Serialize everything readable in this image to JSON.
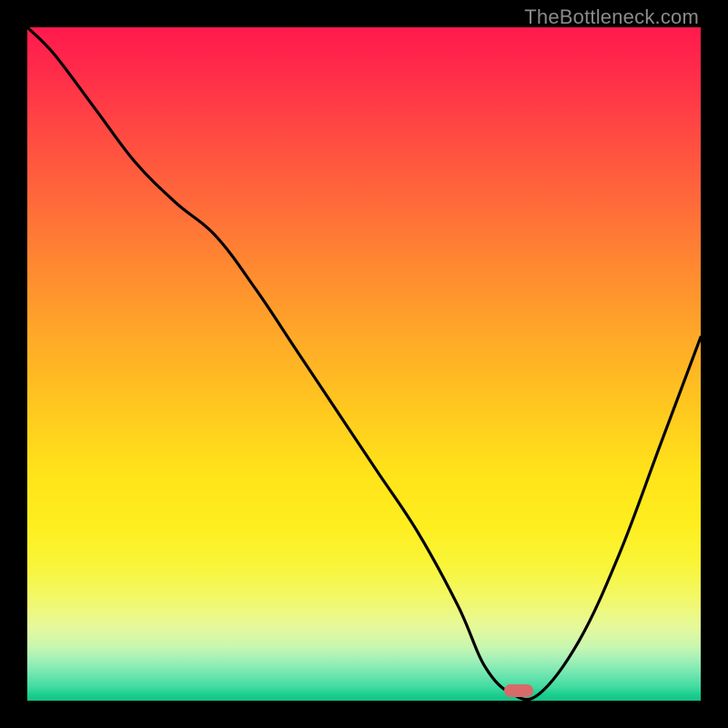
{
  "watermark": "TheBottleneck.com",
  "colors": {
    "frame": "#000000",
    "curve": "#000000",
    "marker": "#d96a6a"
  },
  "chart_data": {
    "type": "line",
    "title": "",
    "xlabel": "",
    "ylabel": "",
    "xlim": [
      0,
      100
    ],
    "ylim": [
      0,
      100
    ],
    "grid": false,
    "legend": false,
    "series": [
      {
        "name": "bottleneck-curve",
        "x": [
          0,
          4,
          10,
          16,
          22,
          28,
          34,
          40,
          46,
          52,
          58,
          64,
          68,
          72,
          76,
          82,
          88,
          94,
          100
        ],
        "y": [
          100,
          96,
          88,
          80,
          74,
          69,
          61,
          52,
          43,
          34,
          25,
          14,
          5,
          1,
          1,
          9,
          22,
          38,
          54
        ]
      }
    ],
    "annotations": [
      {
        "name": "optimal-marker",
        "x": 73,
        "y": 1.5,
        "shape": "pill",
        "color": "#d96a6a"
      }
    ],
    "background_gradient": {
      "orientation": "vertical",
      "stops": [
        {
          "pos": 0.0,
          "color": "#ff1a4d"
        },
        {
          "pos": 0.5,
          "color": "#ffb020"
        },
        {
          "pos": 0.8,
          "color": "#f9f53a"
        },
        {
          "pos": 1.0,
          "color": "#14c285"
        }
      ]
    }
  }
}
